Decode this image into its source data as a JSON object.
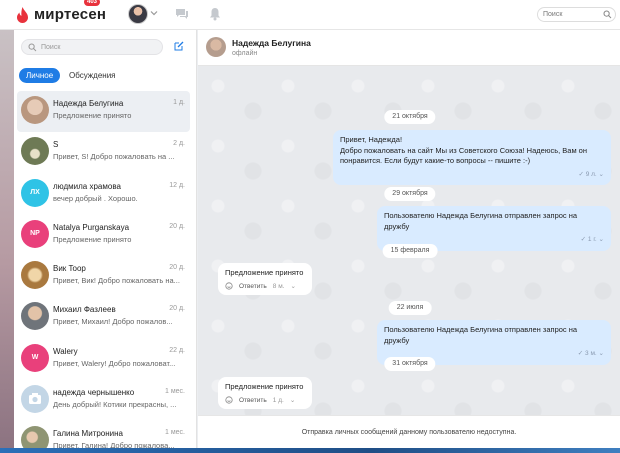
{
  "topbar": {
    "logo_text": "миртесен",
    "badge_count": "403",
    "search_placeholder": "Поиск",
    "brand_color": "#e8323c"
  },
  "sidebar": {
    "search_placeholder": "Поиск",
    "tabs": [
      {
        "label": "Личное",
        "active": true
      },
      {
        "label": "Обсуждения",
        "active": false
      }
    ],
    "dialogs": [
      {
        "name": "Надежда Белугина",
        "snippet": "Предложение принято",
        "date": "1 д.",
        "avatar_initials": "",
        "avatar_color": "#c9a88f",
        "selected": true
      },
      {
        "name": "S",
        "snippet": "Привет, S! Добро пожаловать на ...",
        "date": "2 д.",
        "avatar_initials": "",
        "avatar_color": "#6e7a55",
        "selected": false
      },
      {
        "name": "людмила храмова",
        "snippet": "вечер добрый . Хорошо.",
        "date": "12 д.",
        "avatar_initials": "ЛХ",
        "avatar_color": "#2fc3e6",
        "selected": false
      },
      {
        "name": "Natalya Purganskaya",
        "snippet": "Предложение принято",
        "date": "20 д.",
        "avatar_initials": "NP",
        "avatar_color": "#e9407b",
        "selected": false
      },
      {
        "name": "Вик Toop",
        "snippet": "Привет, Вик! Добро пожаловать на...",
        "date": "20 д.",
        "avatar_initials": "",
        "avatar_color": "#c7a266",
        "selected": false
      },
      {
        "name": "Михаил Фазлеев",
        "snippet": "Привет, Михаил! Добро пожалов...",
        "date": "20 д.",
        "avatar_initials": "",
        "avatar_color": "#8c8f92",
        "selected": false
      },
      {
        "name": "Walery",
        "snippet": "Привет, Walery! Добро пожаловат...",
        "date": "22 д.",
        "avatar_initials": "W",
        "avatar_color": "#e9407b",
        "selected": false
      },
      {
        "name": "надежда чернышенко",
        "snippet": "День добрый! Котики прекрасны, ...",
        "date": "1 мес.",
        "avatar_initials": "",
        "avatar_color": "#c3d6e6",
        "selected": false
      },
      {
        "name": "Галина Митронина",
        "snippet": "Привет, Галина! Добро пожалова...",
        "date": "1 мес.",
        "avatar_initials": "",
        "avatar_color": "#9aa07a",
        "selected": false
      }
    ]
  },
  "chat": {
    "contact_name": "Надежда Белугина",
    "contact_status": "офлайн",
    "dates": [
      "21 октября",
      "29 октября",
      "15 февраля",
      "22 июля",
      "31 октября"
    ],
    "messages": [
      {
        "direction": "out",
        "lines": [
          "Привет, Надежда!",
          "Добро пожаловать на сайт Мы из Советского Союза! Надеюсь, Вам он",
          "понравится. Если будут какие-то вопросы -- пишите :-)"
        ],
        "time": "9 л."
      },
      {
        "direction": "out",
        "lines": [
          "Пользователю Надежда Белугина отправлен запрос на дружбу"
        ],
        "time": "1 г."
      },
      {
        "direction": "in",
        "text": "Предложение принято",
        "reply_label": "Ответить",
        "time": "8 м."
      },
      {
        "direction": "out",
        "lines": [
          "Пользователю Надежда Белугина отправлен запрос на дружбу"
        ],
        "time": "3 м."
      },
      {
        "direction": "in",
        "text": "Предложение принято",
        "reply_label": "Ответить",
        "time": "1 д."
      }
    ],
    "notice": "Отправка личных сообщений данному пользователю недоступна."
  }
}
